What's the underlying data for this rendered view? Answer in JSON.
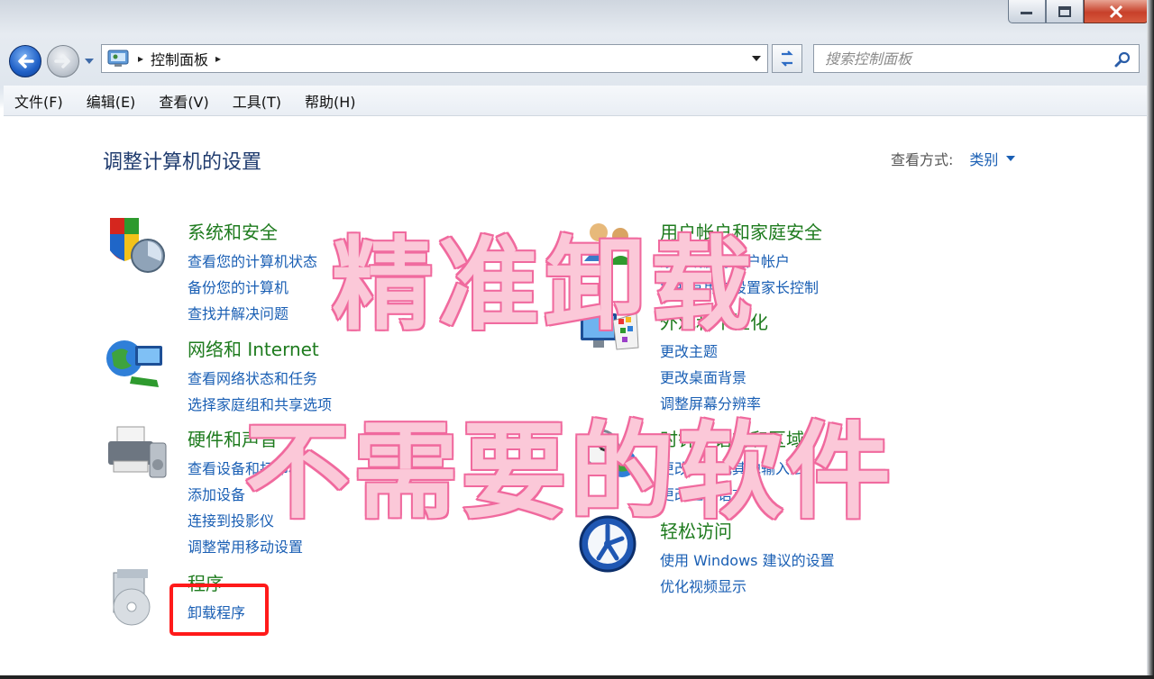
{
  "window": {
    "address": {
      "path": "控制面板",
      "separator": "▸"
    },
    "search": {
      "placeholder": "搜索控制面板"
    },
    "menu": [
      "文件(F)",
      "编辑(E)",
      "查看(V)",
      "工具(T)",
      "帮助(H)"
    ]
  },
  "content": {
    "title": "调整计算机的设置",
    "view_by": {
      "label": "查看方式:",
      "value": "类别"
    },
    "categories": [
      {
        "title": "系统和安全",
        "icon": "shield-icon",
        "links": [
          "查看您的计算机状态",
          "备份您的计算机",
          "查找并解决问题"
        ]
      },
      {
        "title": "网络和 Internet",
        "icon": "network-globe-icon",
        "links": [
          "查看网络状态和任务",
          "选择家庭组和共享选项"
        ]
      },
      {
        "title": "硬件和声音",
        "icon": "printer-icon",
        "links": [
          "查看设备和打印机",
          "添加设备",
          "连接到投影仪",
          "调整常用移动设置"
        ]
      },
      {
        "title": "程序",
        "icon": "programs-disc-icon",
        "links": [
          "卸载程序"
        ]
      },
      {
        "title": "用户帐户和家庭安全",
        "icon": "users-icon",
        "links": [
          "添加或删除用户帐户",
          "为所有用户设置家长控制"
        ]
      },
      {
        "title": "外观和个性化",
        "icon": "monitor-palette-icon",
        "links": [
          "更改主题",
          "更改桌面背景",
          "调整屏幕分辨率"
        ]
      },
      {
        "title": "时钟、语言和区域",
        "icon": "clock-globe-icon",
        "links": [
          "更改键盘或其他输入法",
          "更改显示语言"
        ]
      },
      {
        "title": "轻松访问",
        "icon": "ease-of-access-icon",
        "links": [
          "使用 Windows 建议的设置",
          "优化视频显示"
        ]
      }
    ]
  },
  "overlay": {
    "line1": "精准卸载",
    "line2": "不需要的软件",
    "color_fill": "#fbc8d8",
    "color_stroke": "#f2609a",
    "highlight_color": "#ff1a1a"
  }
}
